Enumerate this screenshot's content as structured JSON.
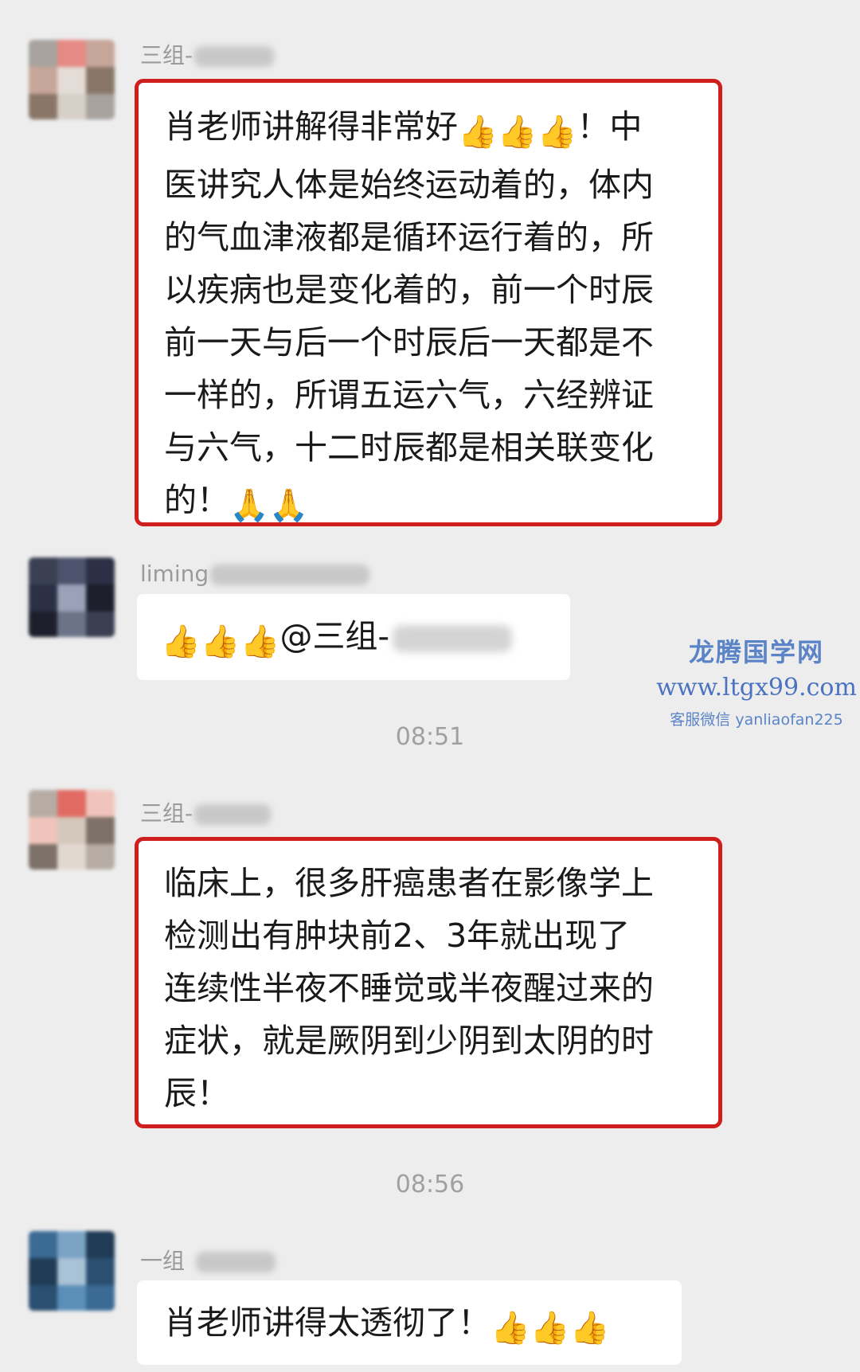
{
  "messages": [
    {
      "sender": "三组-",
      "avatar_colors": [
        "#a8a39e",
        "#d6d0c8",
        "#8a7668",
        "#e4dcd6",
        "#c7a69a",
        "#e58a84"
      ],
      "highlighted": true,
      "lines": [
        "肖老师讲解得非常好[like][like][like]！中",
        "医讲究人体是始终运动着的，体内",
        "的气血津液都是循环运行着的，所",
        "以疾病也是变化着的，前一个时辰",
        "前一天与后一个时辰后一天都是不",
        "一样的，所谓五运六气，六经辨证",
        "与六气，十二时辰都是相关联变化",
        "的！[pray][pray]"
      ]
    },
    {
      "sender": "liming",
      "avatar_colors": [
        "#3a3f52",
        "#6c7288",
        "#1d1f2c",
        "#9aa1b8",
        "#2c3046",
        "#4d536c"
      ],
      "highlighted": false,
      "lines": [
        "[like][like][like]@三组-"
      ]
    },
    {
      "sender": "三组-",
      "avatar_colors": [
        "#b6aca4",
        "#e1d8d0",
        "#7e7168",
        "#d4c8bc",
        "#f0c4bc",
        "#e16b63"
      ],
      "highlighted": true,
      "lines": [
        "临床上，很多肝癌患者在影像学上",
        "检测出有肿块前2、3年就出现了",
        "连续性半夜不睡觉或半夜醒过来的",
        "症状，就是厥阴到少阴到太阴的时",
        "辰！"
      ]
    },
    {
      "sender": "一组",
      "avatar_colors": [
        "#3b6a94",
        "#5b8fb8",
        "#2a4f70",
        "#a9c2d6",
        "#1f3b55",
        "#7aa3c4"
      ],
      "highlighted": false,
      "lines": [
        "肖老师讲得太透彻了！[like][like][like]"
      ]
    }
  ],
  "timestamps": [
    "08:51",
    "08:56"
  ],
  "emoji": {
    "like": "👍",
    "pray": "🙏"
  },
  "watermark": {
    "title": "龙腾国学网",
    "url": "www.ltgx99.com",
    "contact": "客服微信 yanliaofan225"
  }
}
